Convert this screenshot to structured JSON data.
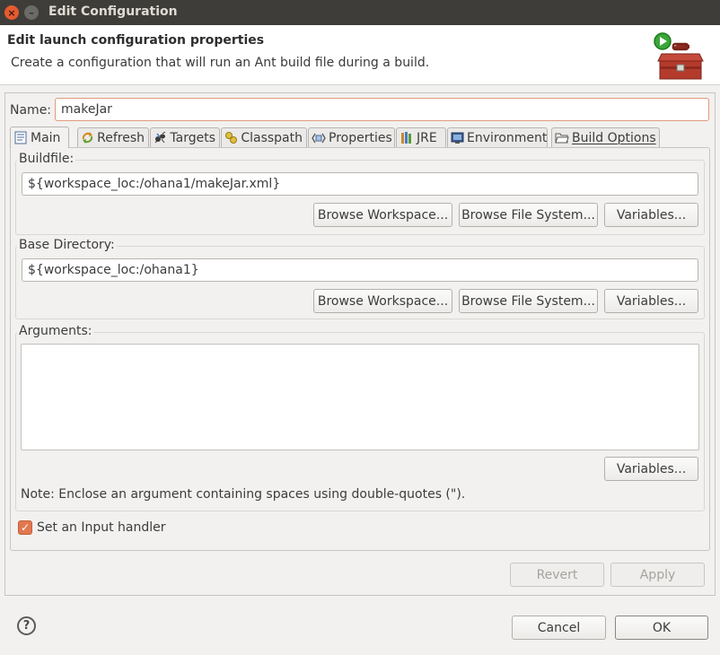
{
  "window": {
    "title": "Edit Configuration",
    "close_glyph": "×",
    "min_glyph": "–"
  },
  "header": {
    "title": "Edit launch configuration properties",
    "description": "Create a configuration that will run an Ant build file during a build.",
    "icon": "ant-toolbox-run-icon"
  },
  "name": {
    "label": "Name:",
    "value": "makeJar"
  },
  "tabs": [
    {
      "label": "Main",
      "icon": "main-tab-icon",
      "active": true
    },
    {
      "label": "Refresh",
      "icon": "refresh-icon"
    },
    {
      "label": "Targets",
      "icon": "ant-targets-icon"
    },
    {
      "label": "Classpath",
      "icon": "classpath-icon"
    },
    {
      "label": "Properties",
      "icon": "properties-icon"
    },
    {
      "label": "JRE",
      "icon": "jre-library-icon"
    },
    {
      "label": "Environment",
      "icon": "environment-icon"
    },
    {
      "label": "Build Options",
      "icon": "folder-open-icon"
    }
  ],
  "buildfile": {
    "label": "Buildfile:",
    "value": "${workspace_loc:/ohana1/makeJar.xml}",
    "browse_workspace": "Browse Workspace...",
    "browse_filesystem": "Browse File System...",
    "variables": "Variables..."
  },
  "base_directory": {
    "label": "Base Directory:",
    "value": "${workspace_loc:/ohana1}",
    "browse_workspace": "Browse Workspace...",
    "browse_filesystem": "Browse File System...",
    "variables": "Variables..."
  },
  "arguments": {
    "label": "Arguments:",
    "value": "",
    "variables": "Variables...",
    "note": "Note: Enclose an argument containing spaces using double-quotes (\")."
  },
  "input_handler": {
    "label": "Set an Input handler",
    "checked": true,
    "check_glyph": "✓"
  },
  "actions": {
    "revert": "Revert",
    "apply": "Apply",
    "cancel": "Cancel",
    "ok": "OK",
    "help_glyph": "?"
  },
  "colors": {
    "accent": "#e1774f",
    "titlebar": "#3e3d39"
  }
}
